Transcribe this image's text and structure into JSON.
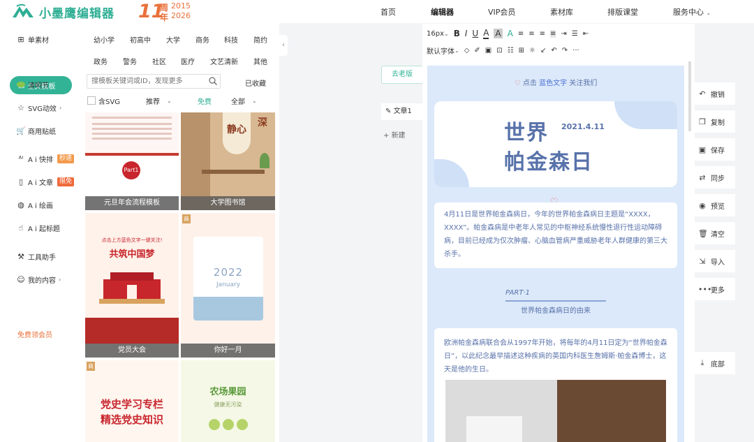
{
  "brand": {
    "name": "小墨鹰编辑器",
    "anniv_num": "11",
    "anniv_zhou": "周",
    "anniv_nian": "年",
    "year_start": "2015",
    "year_end": "2026"
  },
  "topnav": [
    "首页",
    "编辑器",
    "VIP会员",
    "素材库",
    "排版课堂",
    "服务中心"
  ],
  "leftnav": {
    "items": [
      {
        "label": "单素材",
        "icon": "grid-icon"
      },
      {
        "label": "全文模板",
        "icon": "template-icon"
      },
      {
        "label": "清明节",
        "icon": "leaf-icon"
      },
      {
        "label": "SVG动效",
        "icon": "star-icon"
      },
      {
        "label": "商用贴纸",
        "icon": "cart-icon"
      },
      {
        "label": "A i 快排",
        "icon": "ai-icon",
        "badge": "秒速"
      },
      {
        "label": "A i 文章",
        "icon": "document-icon",
        "badge": "限免"
      },
      {
        "label": "A i 绘画",
        "icon": "palette-icon"
      },
      {
        "label": "A i 起标题",
        "icon": "hand-icon"
      },
      {
        "label": "工具助手",
        "icon": "tools-icon"
      },
      {
        "label": "我的内容",
        "icon": "user-icon"
      }
    ],
    "free_member": "免费领会员"
  },
  "templates": {
    "categories_row1": [
      "幼小学",
      "初高中",
      "大学",
      "商务",
      "科技",
      "简约"
    ],
    "categories_row2": [
      "政务",
      "警务",
      "社区",
      "医疗",
      "文艺清新",
      "其他"
    ],
    "search_placeholder": "搜模板关键词或ID，发现更多",
    "collected": "已收藏",
    "svg_filter": "含SVG",
    "recommend": "推荐",
    "free": "免费",
    "all": "全部",
    "items": [
      {
        "caption": "元旦年会流程模板",
        "part": "Part1"
      },
      {
        "caption": "大学图书馆",
        "title_text": "静心",
        "side_text": "深"
      },
      {
        "caption": "党员大会",
        "headline": "共筑中国梦",
        "banner": "点击上方蓝色文字一键关注!"
      },
      {
        "caption": "你好一月",
        "year": "2022",
        "month": "January",
        "tag": "商"
      },
      {
        "headline1": "党史学习专栏",
        "headline2": "精选党史知识",
        "tag": "商"
      },
      {
        "headline": "农场果园",
        "sub": "健康无污染"
      }
    ]
  },
  "editor": {
    "old_version": "去老版",
    "doc_tab": "文章1",
    "new": "新建",
    "toolbar1": [
      "16px",
      "B",
      "I",
      "U",
      "A",
      "A",
      "A"
    ],
    "toolbar2_label": "默认字体"
  },
  "article": {
    "follow_prefix": "点击",
    "follow_link": "蓝色文字",
    "follow_suffix": "关注我们",
    "title_line1": "世界",
    "title_line2": "帕金森日",
    "date": "2021.4.11",
    "para1": "4月11日是世界帕金森病日，今年的世界帕金森病日主题是“XXXX，XXXX”。帕金森病是中老年人常见的中枢神经系统慢性退行性运动障碍病，目前已经成为仅次肿瘤、心脑血管病严重威胁老年人群健康的第三大杀手。",
    "part_label": "PART·1",
    "part_title": "世界帕金森病日的由来",
    "para2": "欧洲帕金森病联合会从1997年开始，将每年的4月11日定为“世界帕金森日”，以此纪念最早描述这种疾病的英国内科医生詹姆斯·帕金森博士，这天是他的生日。"
  },
  "actions": [
    {
      "label": "撤销",
      "icon": "undo-icon"
    },
    {
      "label": "复制",
      "icon": "copy-icon"
    },
    {
      "label": "保存",
      "icon": "save-icon"
    },
    {
      "label": "同步",
      "icon": "sync-icon"
    },
    {
      "label": "预览",
      "icon": "eye-icon"
    },
    {
      "label": "清空",
      "icon": "trash-icon"
    },
    {
      "label": "导入",
      "icon": "import-icon"
    },
    {
      "label": "更多",
      "icon": "more-icon"
    },
    {
      "label": "底部",
      "icon": "arrow-down-icon"
    }
  ],
  "colors": {
    "brand_green": "#33b396",
    "accent_orange": "#e9703a",
    "article_blue": "#5872aa",
    "canvas_bg": "#dce9fa"
  }
}
